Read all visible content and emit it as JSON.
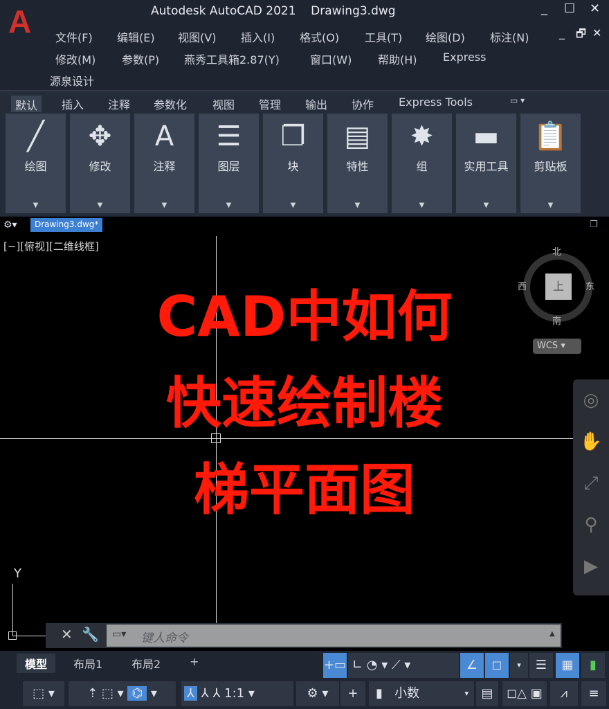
{
  "app": {
    "logo": "A",
    "title": "Autodesk AutoCAD 2021    Drawing3.dwg",
    "window_controls": [
      "_",
      "☐",
      "✕"
    ],
    "doc_controls": [
      "_",
      "🗗",
      "✕"
    ]
  },
  "menu": {
    "items": [
      "文件(F)",
      "编辑(E)",
      "视图(V)",
      "插入(I)",
      "格式(O)",
      "工具(T)",
      "绘图(D)",
      "标注(N)",
      "修改(M)",
      "参数(P)",
      "燕秀工具箱2.87(Y)",
      "窗口(W)",
      "帮助(H)",
      "Express",
      "源泉设计"
    ]
  },
  "ribbon": {
    "tabs": [
      "默认",
      "插入",
      "注释",
      "参数化",
      "视图",
      "管理",
      "输出",
      "协作",
      "Express Tools"
    ],
    "active_tab": "默认",
    "panels": [
      {
        "label": "绘图",
        "icon": "line-icon",
        "glyph": "╱"
      },
      {
        "label": "修改",
        "icon": "move-icon",
        "glyph": "✥"
      },
      {
        "label": "注释",
        "icon": "text-icon",
        "glyph": "A"
      },
      {
        "label": "图层",
        "icon": "layers-icon",
        "glyph": "☰"
      },
      {
        "label": "块",
        "icon": "block-icon",
        "glyph": "❐"
      },
      {
        "label": "特性",
        "icon": "properties-icon",
        "glyph": "▤"
      },
      {
        "label": "组",
        "icon": "group-icon",
        "glyph": "✸"
      },
      {
        "label": "实用工具",
        "icon": "ruler-icon",
        "glyph": "▬"
      },
      {
        "label": "剪贴板",
        "icon": "clipboard-icon",
        "glyph": "📋"
      }
    ]
  },
  "drawing": {
    "doc_tab": "Drawing3.dwg*",
    "view_label": "[−][俯视][二维线框]",
    "overlay_lines": [
      "CAD中如何",
      "快速绘制楼",
      "梯平面图"
    ],
    "overlay_color": "#ff1a0a",
    "compass": {
      "n": "北",
      "s": "南",
      "e": "东",
      "w": "西",
      "top": "上"
    },
    "wcs": "WCS",
    "ucs_y": "Y"
  },
  "command": {
    "placeholder": "键人命令"
  },
  "layout_tabs": [
    "模型",
    "布局1",
    "布局2",
    "+"
  ],
  "status": {
    "scale": "1:1",
    "units": "小数"
  }
}
